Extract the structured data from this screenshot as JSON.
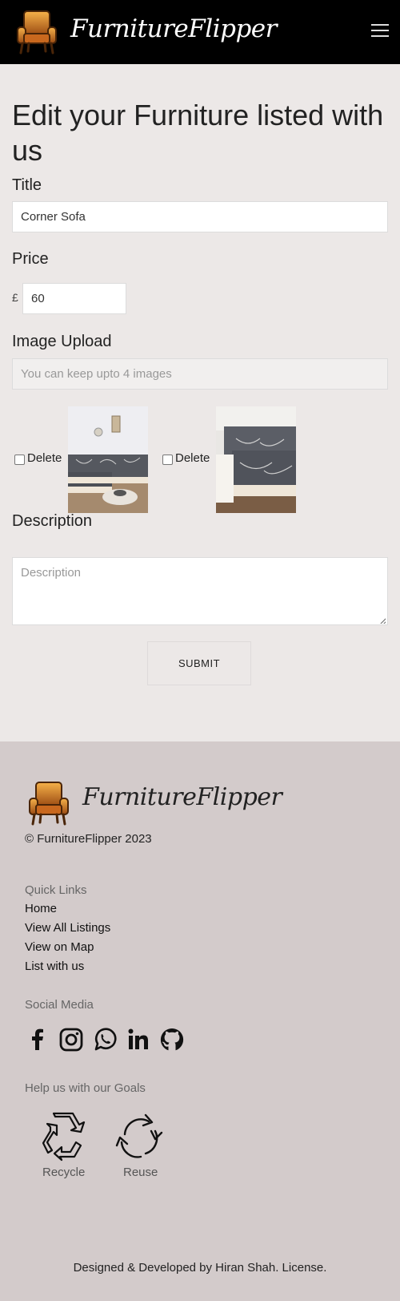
{
  "navbar": {
    "brand": "FurnitureFlipper",
    "logo_icon": "armchair-icon",
    "menu_icon": "hamburger-menu-icon"
  },
  "form": {
    "heading": "Edit your Furniture listed with us",
    "title_label": "Title",
    "title_value": "Corner Sofa",
    "price_label": "Price",
    "currency": "£",
    "price_value": "60",
    "image_label": "Image Upload",
    "image_placeholder": "You can keep upto 4 images",
    "images": [
      {
        "delete_label": "Delete",
        "alt": "Grey corner sofa with cushions",
        "checked": false
      },
      {
        "delete_label": "Delete",
        "alt": "Grey corner sofa close-up",
        "checked": false
      }
    ],
    "description_label": "Description",
    "description_placeholder": "Description",
    "submit_label": "SUBMIT"
  },
  "footer": {
    "brand": "FurnitureFlipper",
    "copyright": "© FurnitureFlipper 2023",
    "quick_links_heading": "Quick Links",
    "quick_links": [
      "Home",
      "View All Listings",
      "View on Map",
      "List with us"
    ],
    "social_heading": "Social Media",
    "social_icons": [
      "facebook-icon",
      "instagram-icon",
      "whatsapp-icon",
      "linkedin-icon",
      "github-icon"
    ],
    "goals_heading": "Help us with our Goals",
    "goals": [
      {
        "label": "Recycle",
        "icon": "recycle-icon"
      },
      {
        "label": "Reuse",
        "icon": "reuse-icon"
      }
    ],
    "credit": "Designed & Developed by Hiran Shah. License."
  },
  "colors": {
    "navbar_bg": "#000000",
    "main_bg": "#ece8e7",
    "footer_bg": "#d3cbcb",
    "logo_orange": "#e08a2c"
  }
}
